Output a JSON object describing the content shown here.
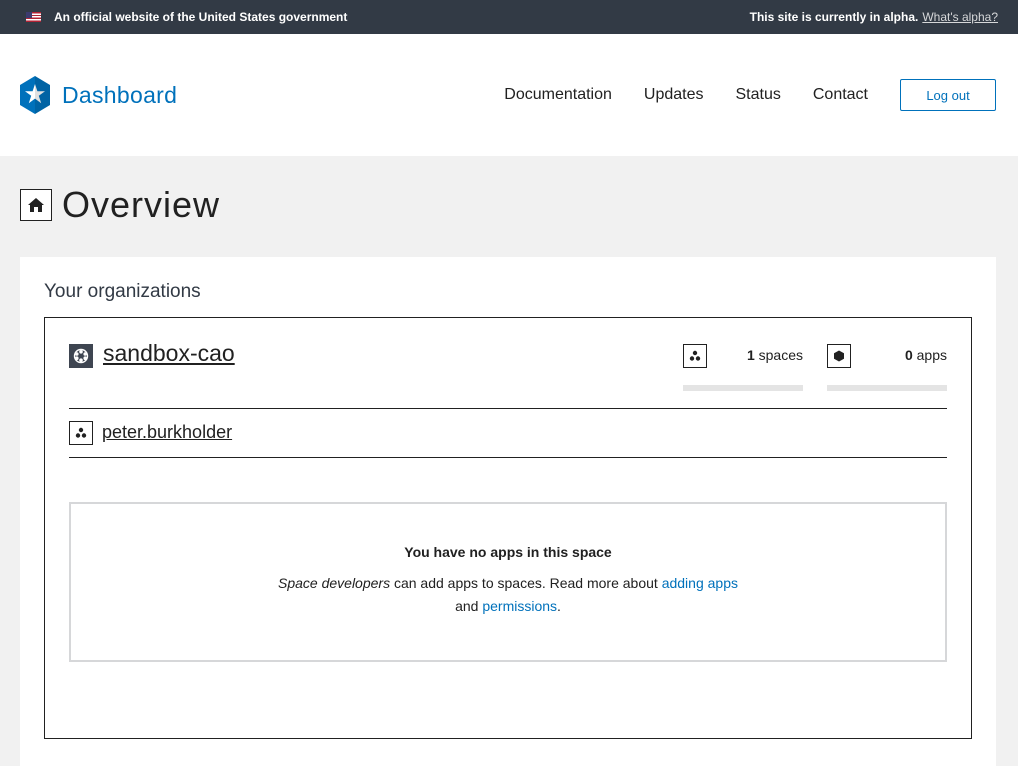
{
  "gov_banner": {
    "official_text": "An official website of the United States government",
    "alpha_text": "This site is currently in alpha.",
    "alpha_link": "What's alpha?"
  },
  "header": {
    "brand": "Dashboard",
    "nav": [
      "Documentation",
      "Updates",
      "Status",
      "Contact"
    ],
    "logout": "Log out"
  },
  "page": {
    "title": "Overview"
  },
  "organizations": {
    "heading": "Your organizations",
    "org": {
      "name": "sandbox-cao",
      "spaces_count": "1",
      "spaces_label": "spaces",
      "apps_count": "0",
      "apps_label": "apps"
    },
    "space": {
      "name": "peter.burkholder"
    },
    "empty": {
      "title": "You have no apps in this space",
      "role": "Space developers",
      "text_1": " can add apps to spaces. Read more about ",
      "link_1": "adding apps",
      "text_2": "and ",
      "link_2": "permissions",
      "text_3": "."
    }
  },
  "colors": {
    "brand": "#0071bb",
    "banner": "#323a45",
    "background": "#f1f1f1"
  },
  "icons": [
    "us-flag-icon",
    "dashboard-star-logo",
    "home-icon",
    "org-icon",
    "spaces-icon",
    "apps-icon",
    "space-icon"
  ]
}
